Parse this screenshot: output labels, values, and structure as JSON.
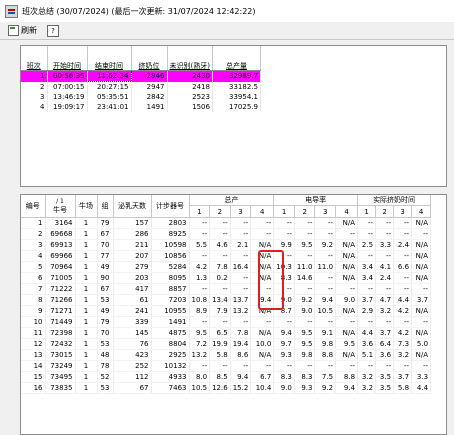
{
  "window": {
    "title": "班次总结 (30/07/2024) (最后一次更新: 31/07/2024 12:42:22)"
  },
  "toolbar": {
    "refresh_label": "刷新",
    "help_label": "?"
  },
  "shift_table": {
    "headers": [
      "班次",
      "开始时间",
      "结束时间",
      "挤奶位",
      "未识别(熟牙)",
      "总产量"
    ],
    "selected_row": 0,
    "rows": [
      [
        "1",
        "00:56:35",
        "11:52:34",
        "2946",
        "2430",
        "32989.7"
      ],
      [
        "2",
        "07:00:15",
        "20:27:15",
        "2947",
        "2418",
        "33182.5"
      ],
      [
        "3",
        "13:46:19",
        "05:35:51",
        "2842",
        "2523",
        "33954.1"
      ],
      [
        "4",
        "19:09:17",
        "23:41:01",
        "1491",
        "1506",
        "17025.9"
      ]
    ]
  },
  "cow_table": {
    "group_headers": [
      "总产",
      "电导率",
      "实际挤奶时间"
    ],
    "fixed_headers": [
      "编号",
      "牛号",
      "牛场",
      "组",
      "泌乳天数",
      "计步器号"
    ],
    "sort_indicator": "/ 1",
    "sub_headers": [
      "1",
      "2",
      "3",
      "4",
      "1",
      "2",
      "3",
      "4",
      "1",
      "2",
      "3",
      "4"
    ],
    "rows": [
      [
        "1",
        "3164",
        "1",
        "79",
        "157",
        "2803",
        "--",
        "--",
        "--",
        "--",
        "--",
        "--",
        "--",
        "N/A",
        "--",
        "--",
        "--",
        "N/A"
      ],
      [
        "2",
        "69668",
        "1",
        "67",
        "286",
        "8925",
        "--",
        "--",
        "--",
        "--",
        "--",
        "--",
        "--",
        "--",
        "--",
        "--",
        "--",
        "--"
      ],
      [
        "3",
        "69913",
        "1",
        "70",
        "211",
        "10598",
        "5.5",
        "4.6",
        "2.1",
        "N/A",
        "9.9",
        "9.5",
        "9.2",
        "N/A",
        "2.5",
        "3.3",
        "2.4",
        "N/A"
      ],
      [
        "4",
        "69966",
        "1",
        "77",
        "207",
        "10856",
        "--",
        "--",
        "--",
        "N/A",
        "--",
        "--",
        "--",
        "N/A",
        "--",
        "--",
        "--",
        "N/A"
      ],
      [
        "5",
        "70964",
        "1",
        "49",
        "279",
        "5284",
        "4.2",
        "7.8",
        "16.4",
        "N/A",
        "10.3",
        "11.0",
        "11.0",
        "N/A",
        "3.4",
        "4.1",
        "6.6",
        "N/A"
      ],
      [
        "6",
        "71005",
        "1",
        "90",
        "203",
        "8095",
        "1.3",
        "0.2",
        "--",
        "N/A",
        "8.3",
        "14.6",
        "--",
        "N/A",
        "3.4",
        "2.4",
        "--",
        "N/A"
      ],
      [
        "7",
        "71222",
        "1",
        "67",
        "417",
        "8857",
        "--",
        "--",
        "--",
        "--",
        "--",
        "--",
        "--",
        "--",
        "--",
        "--",
        "--",
        "--"
      ],
      [
        "8",
        "71266",
        "1",
        "53",
        "61",
        "7203",
        "10.8",
        "13.4",
        "13.7",
        "9.4",
        "9.0",
        "9.2",
        "9.4",
        "9.0",
        "3.7",
        "4.7",
        "4.4",
        "3.7"
      ],
      [
        "9",
        "71271",
        "1",
        "49",
        "241",
        "10955",
        "8.9",
        "7.9",
        "13.2",
        "N/A",
        "8.7",
        "9.0",
        "10.5",
        "N/A",
        "2.9",
        "3.2",
        "4.2",
        "N/A"
      ],
      [
        "10",
        "71449",
        "1",
        "79",
        "339",
        "1491",
        "--",
        "--",
        "--",
        "--",
        "--",
        "--",
        "--",
        "--",
        "--",
        "--",
        "--",
        "--"
      ],
      [
        "11",
        "72398",
        "1",
        "70",
        "145",
        "4875",
        "9.5",
        "6.5",
        "7.8",
        "N/A",
        "9.4",
        "9.5",
        "9.1",
        "N/A",
        "4.4",
        "3.7",
        "4.2",
        "N/A"
      ],
      [
        "12",
        "72432",
        "1",
        "53",
        "76",
        "8804",
        "7.2",
        "19.9",
        "19.4",
        "10.0",
        "9.7",
        "9.5",
        "9.8",
        "9.5",
        "3.6",
        "6.4",
        "7.3",
        "5.0"
      ],
      [
        "13",
        "73015",
        "1",
        "48",
        "423",
        "2925",
        "13.2",
        "5.8",
        "8.6",
        "N/A",
        "9.3",
        "9.8",
        "8.8",
        "N/A",
        "5.1",
        "3.6",
        "3.2",
        "N/A"
      ],
      [
        "14",
        "73249",
        "1",
        "78",
        "252",
        "10132",
        "--",
        "--",
        "--",
        "--",
        "--",
        "--",
        "--",
        "--",
        "--",
        "--",
        "--",
        "--"
      ],
      [
        "15",
        "73495",
        "1",
        "52",
        "112",
        "4933",
        "8.0",
        "8.5",
        "9.4",
        "6.7",
        "8.3",
        "8.3",
        "7.5",
        "8.8",
        "3.2",
        "3.5",
        "3.7",
        "3.3"
      ],
      [
        "16",
        "73835",
        "1",
        "53",
        "67",
        "7463",
        "10.5",
        "12.6",
        "15.2",
        "10.4",
        "9.0",
        "9.3",
        "9.2",
        "9.4",
        "3.2",
        "3.5",
        "5.8",
        "4.4"
      ]
    ]
  }
}
